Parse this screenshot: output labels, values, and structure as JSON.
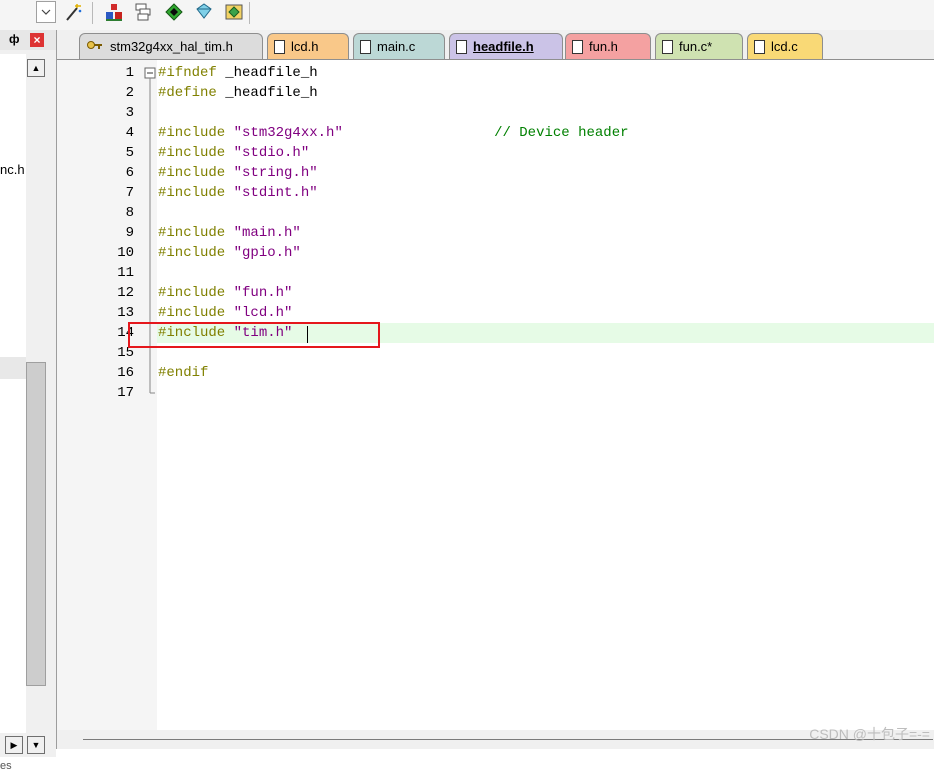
{
  "toolbar": {
    "icons": [
      "dropdown-icon",
      "magic-wand-icon",
      "batch-build-icon",
      "window-stack-icon",
      "green-diamond-icon",
      "download-icon",
      "settings-chip-icon"
    ]
  },
  "left_panel": {
    "pin_glyph": "ф",
    "close_glyph": "×",
    "visible_item": "nc.h",
    "status_text": "es"
  },
  "tabs": [
    {
      "label": "stm32g4xx_hal_tim.h",
      "color": "#dcdcdc",
      "icon": "key-icon",
      "active": false
    },
    {
      "label": "lcd.h",
      "color": "#f9c889",
      "icon": "file-icon",
      "active": false
    },
    {
      "label": "main.c",
      "color": "#bcd8d6",
      "icon": "file-icon",
      "active": false
    },
    {
      "label": "headfile.h",
      "color": "#cbc3e7",
      "icon": "file-icon",
      "active": true
    },
    {
      "label": "fun.h",
      "color": "#f4a1a1",
      "icon": "file-icon",
      "active": false
    },
    {
      "label": "fun.c*",
      "color": "#cfe2b1",
      "icon": "file-icon",
      "active": false
    },
    {
      "label": "lcd.c",
      "color": "#f9d976",
      "icon": "file-icon",
      "active": false
    }
  ],
  "editor": {
    "lines": [
      {
        "n": "1",
        "kw": "#ifndef",
        "rest": " _headfile_h",
        "str": "",
        "cm": ""
      },
      {
        "n": "2",
        "kw": "#define",
        "rest": " _headfile_h",
        "str": "",
        "cm": ""
      },
      {
        "n": "3",
        "kw": "",
        "rest": "",
        "str": "",
        "cm": ""
      },
      {
        "n": "4",
        "kw": "#include",
        "rest": " ",
        "str": "\"stm32g4xx.h\"",
        "cm": "                  // Device header"
      },
      {
        "n": "5",
        "kw": "#include",
        "rest": " ",
        "str": "\"stdio.h\"",
        "cm": ""
      },
      {
        "n": "6",
        "kw": "#include",
        "rest": " ",
        "str": "\"string.h\"",
        "cm": ""
      },
      {
        "n": "7",
        "kw": "#include",
        "rest": " ",
        "str": "\"stdint.h\"",
        "cm": ""
      },
      {
        "n": "8",
        "kw": "",
        "rest": "",
        "str": "",
        "cm": ""
      },
      {
        "n": "9",
        "kw": "#include",
        "rest": " ",
        "str": "\"main.h\"",
        "cm": ""
      },
      {
        "n": "10",
        "kw": "#include",
        "rest": " ",
        "str": "\"gpio.h\"",
        "cm": ""
      },
      {
        "n": "11",
        "kw": "",
        "rest": "",
        "str": "",
        "cm": ""
      },
      {
        "n": "12",
        "kw": "#include",
        "rest": " ",
        "str": "\"fun.h\"",
        "cm": ""
      },
      {
        "n": "13",
        "kw": "#include",
        "rest": " ",
        "str": "\"lcd.h\"",
        "cm": ""
      },
      {
        "n": "14",
        "kw": "#include",
        "rest": " ",
        "str": "\"tim.h\"",
        "cm": ""
      },
      {
        "n": "15",
        "kw": "",
        "rest": "",
        "str": "",
        "cm": ""
      },
      {
        "n": "16",
        "kw": "#endif",
        "rest": "",
        "str": "",
        "cm": ""
      },
      {
        "n": "17",
        "kw": "",
        "rest": "",
        "str": "",
        "cm": ""
      }
    ],
    "current_line": "14",
    "highlight_color": "#e5171c"
  },
  "watermark": "CSDN @十包子=-="
}
